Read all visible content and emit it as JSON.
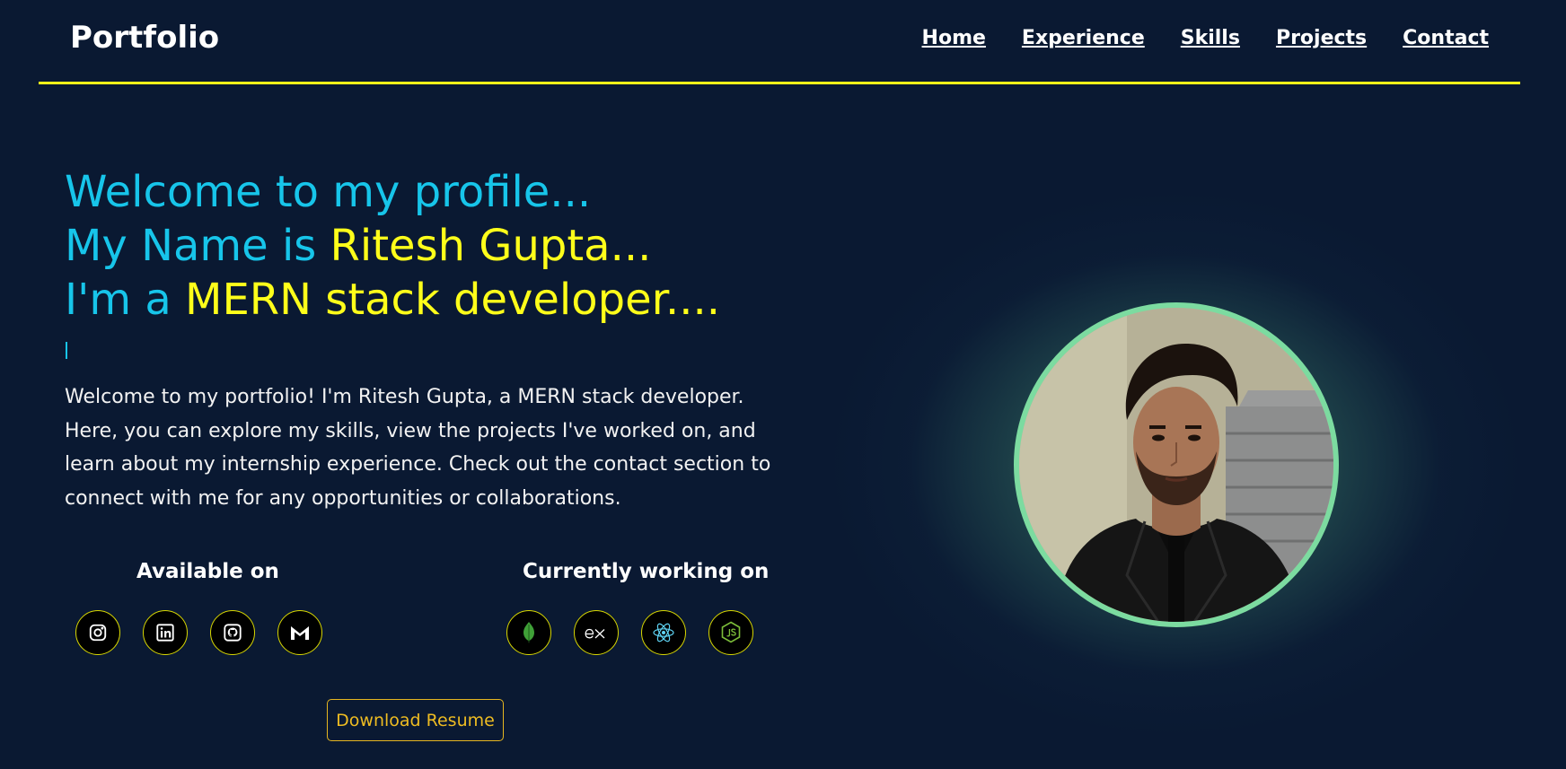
{
  "nav": {
    "brand": "Portfolio",
    "links": [
      "Home",
      "Experience",
      "Skills",
      "Projects",
      "Contact"
    ]
  },
  "hero": {
    "line1": "Welcome to my profile...",
    "line2_prefix": "My Name is ",
    "line2_name": "Ritesh Gupta...",
    "line3_prefix": "I'm a ",
    "line3_role": "MERN stack developer....",
    "intro": "Welcome to my portfolio! I'm Ritesh Gupta, a MERN stack developer. Here, you can explore my skills, view the projects I've worked on, and learn about my internship experience. Check out the contact section to connect with me for any opportunities or collaborations."
  },
  "available": {
    "title": "Available on",
    "icons": [
      "instagram-icon",
      "linkedin-icon",
      "github-icon",
      "gmail-icon"
    ]
  },
  "working": {
    "title": "Currently working on",
    "icons": [
      "mongodb-icon",
      "express-icon",
      "react-icon",
      "nodejs-icon"
    ]
  },
  "resume_button": "Download Resume",
  "colors": {
    "background": "#0a1932",
    "accent_yellow": "#ffff1a",
    "accent_cyan": "#17c5ea",
    "profile_border": "#7cdba0",
    "button_gold": "#eebc22"
  }
}
